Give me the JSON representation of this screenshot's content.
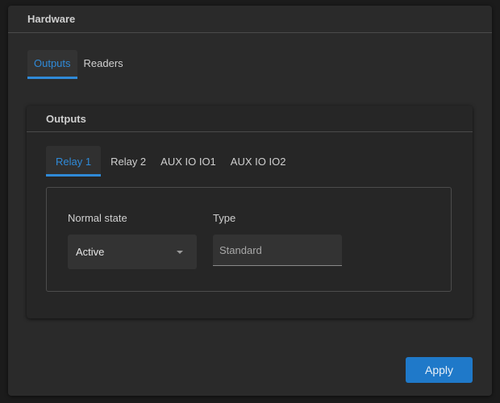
{
  "card": {
    "title": "Hardware"
  },
  "top_tabs": [
    {
      "label": "Outputs",
      "active": true
    },
    {
      "label": "Readers",
      "active": false
    }
  ],
  "outputs_card": {
    "title": "Outputs",
    "tabs": [
      {
        "label": "Relay 1",
        "active": true
      },
      {
        "label": "Relay 2",
        "active": false
      },
      {
        "label": "AUX IO IO1",
        "active": false
      },
      {
        "label": "AUX IO IO2",
        "active": false
      }
    ],
    "normal_state": {
      "label": "Normal state",
      "value": "Active"
    },
    "type": {
      "label": "Type",
      "placeholder": "Standard",
      "value": ""
    }
  },
  "apply_label": "Apply",
  "colors": {
    "accent": "#2f8ad8",
    "button": "#1f79c9",
    "background": "#2a2a2a"
  }
}
